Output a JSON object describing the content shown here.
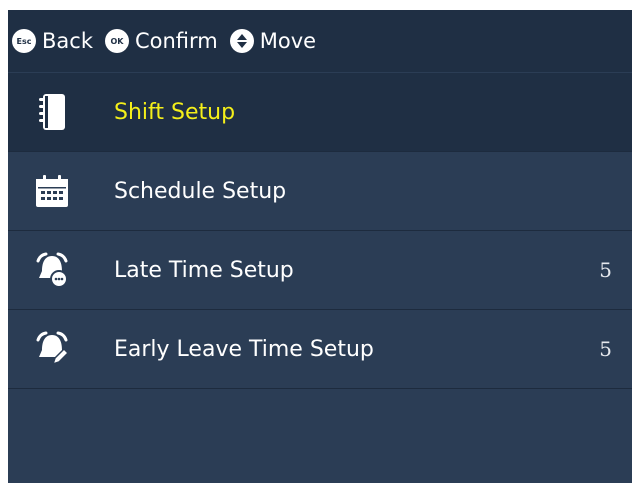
{
  "hints": [
    {
      "key_icon": "esc-key-icon",
      "key_text": "Esc",
      "label": "Back"
    },
    {
      "key_icon": "ok-key-icon",
      "key_text": "OK",
      "label": "Confirm"
    },
    {
      "key_icon": "up-down-key-icon",
      "key_text": "",
      "label": "Move"
    }
  ],
  "menu": {
    "items": [
      {
        "icon": "notebook-icon",
        "label": "Shift Setup",
        "value": "",
        "selected": true
      },
      {
        "icon": "calendar-icon",
        "label": "Schedule Setup",
        "value": ""
      },
      {
        "icon": "alarm-clock-icon",
        "label": "Late Time Setup",
        "value": "5"
      },
      {
        "icon": "alarm-clock-edit-icon",
        "label": "Early Leave Time Setup",
        "value": "5"
      }
    ]
  },
  "colors": {
    "background": "#2b3d55",
    "header": "#1f2f44",
    "selected_text": "#f4ef1a",
    "text": "#ffffff"
  }
}
